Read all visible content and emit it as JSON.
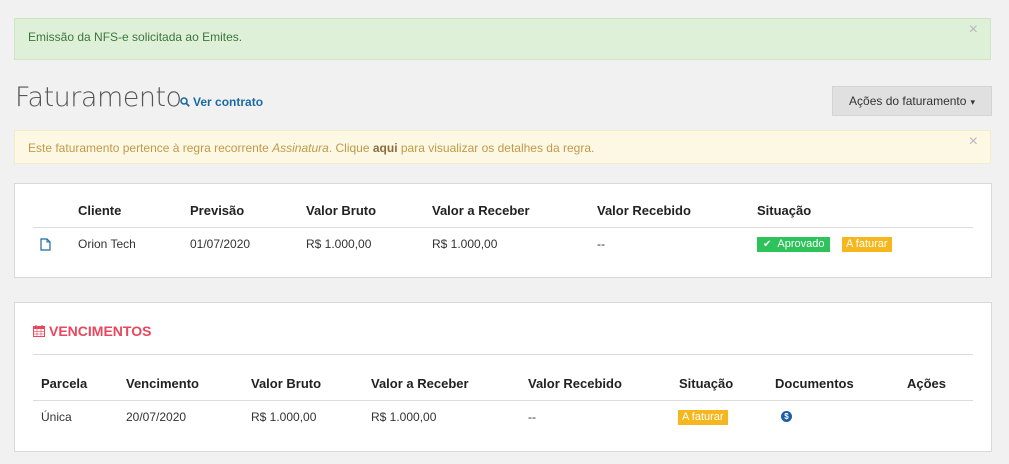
{
  "alert_success": {
    "message": "Emissão da NFS-e solicitada ao Emites.",
    "close": "×"
  },
  "header": {
    "title": "Faturamento",
    "ver_contrato": "Ver contrato",
    "acoes_button": "Ações do faturamento",
    "acoes_chevron": "⌄"
  },
  "alert_warning": {
    "text_before": "Este faturamento pertence à regra recorrente ",
    "rule_name": "Assinatura",
    "text_middle": ". Clique ",
    "link": "aqui",
    "text_after": " para visualizar os detalhes da regra.",
    "close": "×"
  },
  "billing_table": {
    "columns": [
      "Cliente",
      "Previsão",
      "Valor Bruto",
      "Valor a Receber",
      "Valor Recebido",
      "Situação"
    ],
    "row": {
      "cliente": "Orion Tech",
      "previsao": "01/07/2020",
      "valor_bruto": "R$ 1.000,00",
      "valor_a_receber": "R$ 1.000,00",
      "valor_recebido": "--",
      "status_approved": "Aprovado",
      "status_pending": "A faturar"
    }
  },
  "vencimentos": {
    "title": "VENCIMENTOS",
    "columns": [
      "Parcela",
      "Vencimento",
      "Valor Bruto",
      "Valor a Receber",
      "Valor Recebido",
      "Situação",
      "Documentos",
      "Ações"
    ],
    "row": {
      "parcela": "Única",
      "vencimento": "20/07/2020",
      "valor_bruto": "R$ 1.000,00",
      "valor_a_receber": "R$ 1.000,00",
      "valor_recebido": "--",
      "situacao": "A faturar",
      "documento_icon": "$"
    }
  },
  "colors": {
    "success_bg": "#dff0d8",
    "warning_bg": "#fcf8e3",
    "badge_green": "#2ec25a",
    "badge_orange": "#f6b61e",
    "section_title": "#e9475d",
    "link_blue": "#1b6aa5"
  }
}
